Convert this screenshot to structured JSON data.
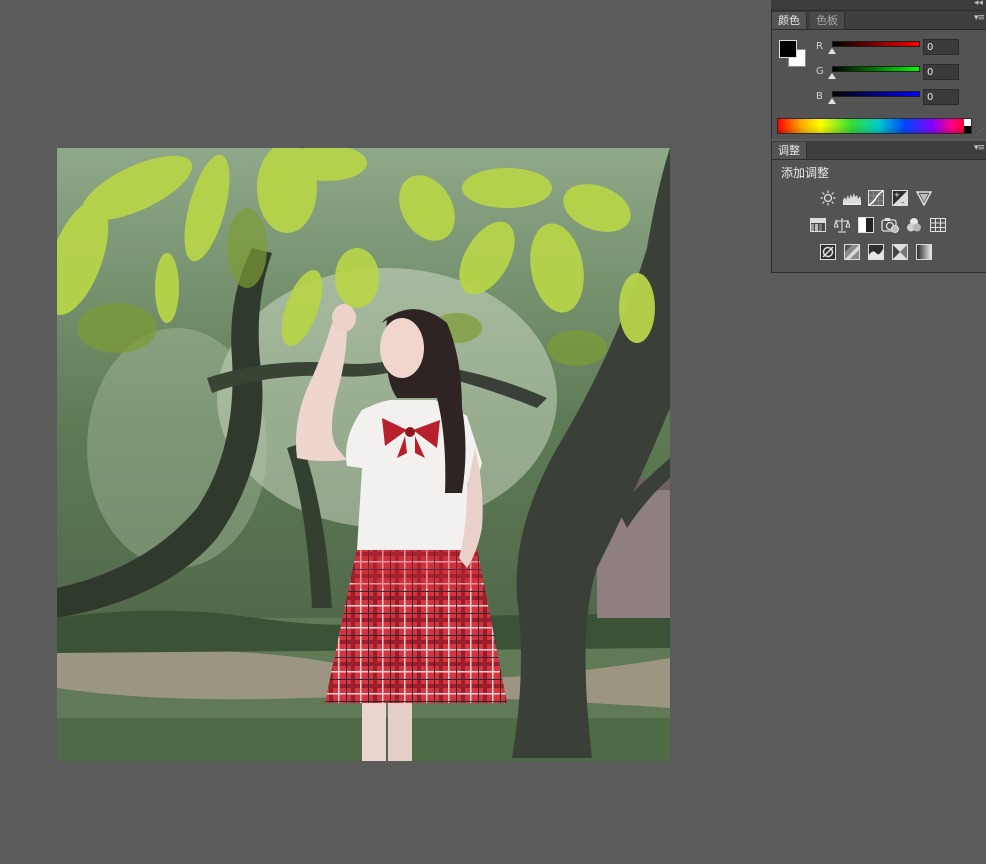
{
  "color_panel": {
    "tabs": [
      {
        "label": "颜色",
        "active": true
      },
      {
        "label": "色板",
        "active": false
      }
    ],
    "foreground": "#000000",
    "background": "#ffffff",
    "channels": [
      {
        "label": "R",
        "value": "0",
        "gradient": "#ff0000"
      },
      {
        "label": "G",
        "value": "0",
        "gradient": "#00ff00"
      },
      {
        "label": "B",
        "value": "0",
        "gradient": "#0000ff"
      }
    ]
  },
  "adjustments_panel": {
    "tabs": [
      {
        "label": "调整",
        "active": true
      }
    ],
    "title": "添加调整",
    "icon_rows": [
      [
        "brightness-contrast-icon",
        "levels-icon",
        "curves-icon",
        "exposure-icon",
        "vibrance-icon"
      ],
      [
        "hue-saturation-icon",
        "color-balance-icon",
        "black-white-icon",
        "photo-filter-icon",
        "channel-mixer-icon",
        "color-lookup-icon"
      ],
      [
        "invert-icon",
        "posterize-icon",
        "threshold-icon",
        "selective-color-icon",
        "gradient-map-icon"
      ]
    ]
  }
}
